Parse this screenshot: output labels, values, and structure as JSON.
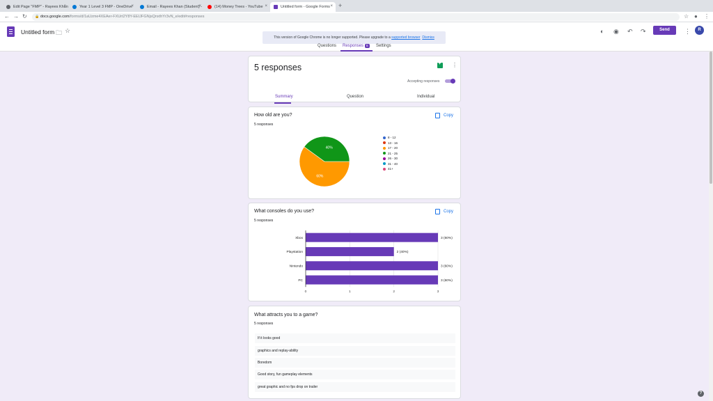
{
  "browser": {
    "tabs": [
      {
        "title": "Edit Page \"FMP\" - Rayees Khan",
        "color": "#5f6368"
      },
      {
        "title": "Year 1 Level 3 FMP - OneDrive",
        "color": "#0078d4"
      },
      {
        "title": "Email - Rayees Khan (Student) -",
        "color": "#0078d4"
      },
      {
        "title": "(14) Money Trees - YouTube",
        "color": "#ff0000"
      },
      {
        "title": "Untitled form - Google Forms",
        "color": "#673ab7"
      }
    ],
    "new_tab": "+",
    "url_host": "docs.google.com",
    "url_path": "/forms/d/1aUzme4XEAer-FXUrt2Y8Y-EEIJFGNjsQnxthYr3vN_e/edit#responses"
  },
  "header": {
    "form_title": "Untitled form",
    "send_label": "Send",
    "avatar_initial": "R",
    "notice_text": "This version of Google Chrome is no longer supported. Please upgrade to a",
    "notice_link": "supported browser",
    "notice_dismiss": "Dismiss",
    "tabs": {
      "questions": "Questions",
      "responses": "Responses",
      "responses_badge": "5",
      "settings": "Settings"
    }
  },
  "summary": {
    "title": "5 responses",
    "accepting_label": "Accepting responses",
    "accepting": true,
    "subtabs": {
      "summary": "Summary",
      "question": "Question",
      "individual": "Individual"
    }
  },
  "q1": {
    "title": "How old are you?",
    "count": "5 responses",
    "copy": "Copy",
    "legend": [
      {
        "label": "8 - 12",
        "color": "#3366cc"
      },
      {
        "label": "13 - 16",
        "color": "#dc3912"
      },
      {
        "label": "17 - 20",
        "color": "#ff9900"
      },
      {
        "label": "21 - 25",
        "color": "#109618"
      },
      {
        "label": "26 - 30",
        "color": "#990099"
      },
      {
        "label": "31 - 40",
        "color": "#0099c6"
      },
      {
        "label": "41+",
        "color": "#dd4477"
      }
    ]
  },
  "q2": {
    "title": "What consoles do you use?",
    "count": "5 responses",
    "copy": "Copy"
  },
  "q3": {
    "title": "What attracts you to a game?",
    "count": "5 responses",
    "answers": [
      "If it looks good",
      "graphics and replay-ability",
      "Boredom",
      "Good story, fun gameplay elements",
      "great graphic and no fps drop on trailer"
    ]
  },
  "chart_data": [
    {
      "type": "pie",
      "title": "How old are you?",
      "slices": [
        {
          "label": "17 - 20",
          "value": 60,
          "display": "60%",
          "color": "#ff9900"
        },
        {
          "label": "21 - 25",
          "value": 40,
          "display": "40%",
          "color": "#109618"
        }
      ]
    },
    {
      "type": "bar",
      "orientation": "horizontal",
      "title": "What consoles do you use?",
      "categories": [
        "Xbox",
        "Playstation",
        "Nintendo",
        "PC"
      ],
      "values": [
        3,
        2,
        3,
        3
      ],
      "labels": [
        "3 (60%)",
        "2 (40%)",
        "3 (60%)",
        "3 (60%)"
      ],
      "xlim": [
        0,
        3
      ],
      "ticks": [
        0,
        1,
        2,
        3
      ],
      "color": "#673ab7",
      "grid": true
    }
  ]
}
